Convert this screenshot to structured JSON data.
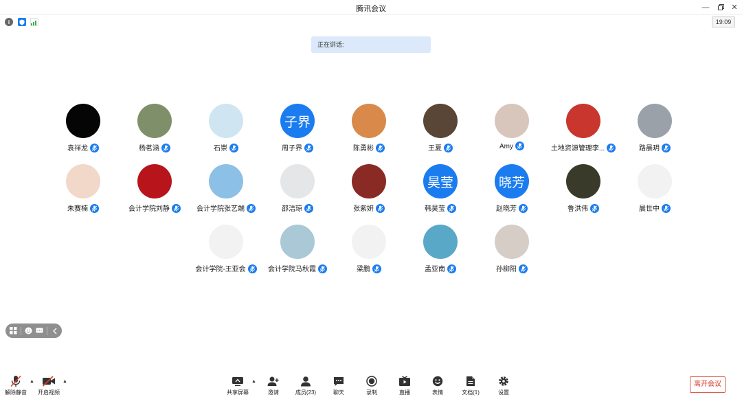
{
  "window": {
    "title": "腾讯会议"
  },
  "clock": "19:09",
  "speaking_label": "正在讲话:",
  "participants": [
    {
      "name": "袁祥龙",
      "avatar_text": "",
      "bg": "#050505"
    },
    {
      "name": "杨茗涵",
      "avatar_text": "",
      "bg": "#7f8f6a"
    },
    {
      "name": "石崇",
      "avatar_text": "",
      "bg": "#cfe6f2"
    },
    {
      "name": "周子界",
      "avatar_text": "子界",
      "bg": "#1b7cf0"
    },
    {
      "name": "陈勇彬",
      "avatar_text": "",
      "bg": "#d98a4a"
    },
    {
      "name": "王夏",
      "avatar_text": "",
      "bg": "#5a4636"
    },
    {
      "name": "Amy",
      "avatar_text": "",
      "bg": "#d8c6bc"
    },
    {
      "name": "土地资源管理李...",
      "avatar_text": "",
      "bg": "#c8362e"
    },
    {
      "name": "路晨玥",
      "avatar_text": "",
      "bg": "#9aa1a8"
    },
    {
      "name": "朱赛楠",
      "avatar_text": "",
      "bg": "#f1d8c8"
    },
    {
      "name": "会计学院刘静",
      "avatar_text": "",
      "bg": "#b8141c"
    },
    {
      "name": "会计学院张艺端",
      "avatar_text": "",
      "bg": "#8cc0e6"
    },
    {
      "name": "邵洁琼",
      "avatar_text": "",
      "bg": "#e4e6e8"
    },
    {
      "name": "张紫妍",
      "avatar_text": "",
      "bg": "#8a2a24"
    },
    {
      "name": "韩昊莹",
      "avatar_text": "昊莹",
      "bg": "#1b7cf0"
    },
    {
      "name": "赵晓芳",
      "avatar_text": "晓芳",
      "bg": "#1b7cf0"
    },
    {
      "name": "鲁洪伟",
      "avatar_text": "",
      "bg": "#3a3a2a"
    },
    {
      "name": "晨世中",
      "avatar_text": "",
      "bg": "#f2f2f2"
    },
    {
      "name": "会计学院-王亚会",
      "avatar_text": "",
      "bg": "#f2f2f2"
    },
    {
      "name": "会计学院马秋霞",
      "avatar_text": "",
      "bg": "#aac8d6"
    },
    {
      "name": "梁鹏",
      "avatar_text": "",
      "bg": "#f2f2f2"
    },
    {
      "name": "孟亚南",
      "avatar_text": "",
      "bg": "#5aa8c8"
    },
    {
      "name": "孙柳阳",
      "avatar_text": "",
      "bg": "#d6cdc6"
    }
  ],
  "toolbar": {
    "unmute": "解除静音",
    "start_video": "开启视频",
    "share_screen": "共享屏幕",
    "invite": "邀请",
    "members": "成员(23)",
    "chat": "聊天",
    "record": "录制",
    "live": "直播",
    "reactions": "表情",
    "docs": "文档(1)",
    "settings": "设置",
    "leave": "离开会议"
  },
  "colors": {
    "accent": "#1b7cf0",
    "danger": "#d93a2a",
    "banner": "#dbe9fb"
  }
}
